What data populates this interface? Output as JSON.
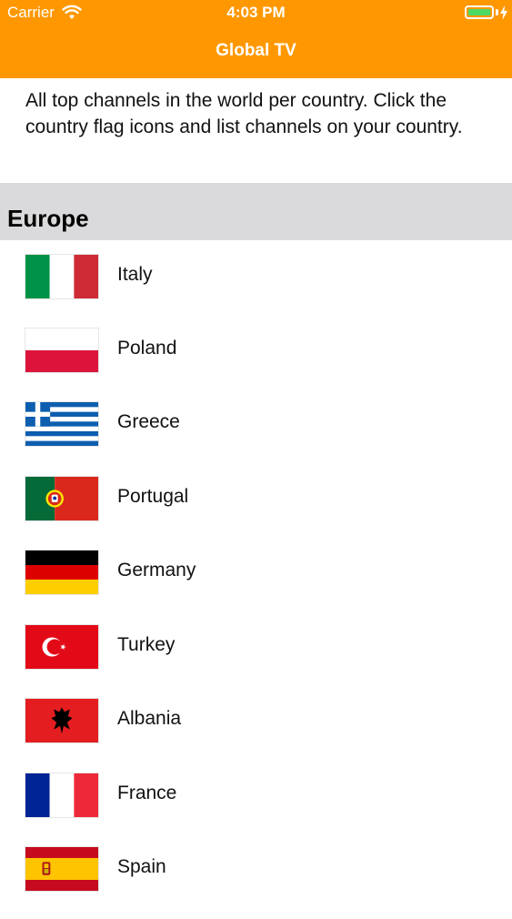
{
  "status_bar": {
    "carrier": "Carrier",
    "time": "4:03 PM"
  },
  "nav": {
    "title": "Global TV"
  },
  "intro_text": "All top channels in the world per country. Click the country flag icons and list channels on your country.",
  "section": {
    "title": "Europe"
  },
  "countries": [
    {
      "name": "Italy",
      "flag_icon": "italy-flag-icon"
    },
    {
      "name": "Poland",
      "flag_icon": "poland-flag-icon"
    },
    {
      "name": "Greece",
      "flag_icon": "greece-flag-icon"
    },
    {
      "name": "Portugal",
      "flag_icon": "portugal-flag-icon"
    },
    {
      "name": "Germany",
      "flag_icon": "germany-flag-icon"
    },
    {
      "name": "Turkey",
      "flag_icon": "turkey-flag-icon"
    },
    {
      "name": "Albania",
      "flag_icon": "albania-flag-icon"
    },
    {
      "name": "France",
      "flag_icon": "france-flag-icon"
    },
    {
      "name": "Spain",
      "flag_icon": "spain-flag-icon"
    }
  ],
  "colors": {
    "accent": "#FF9800",
    "section_bg": "#DADADC",
    "battery": "#4CD964"
  }
}
